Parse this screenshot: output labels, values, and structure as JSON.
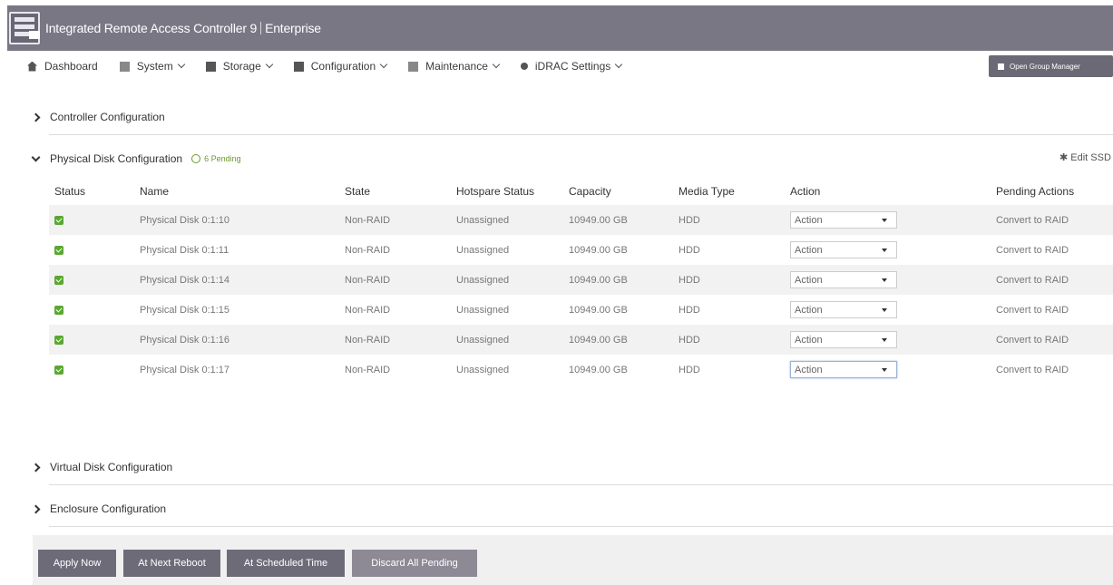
{
  "header": {
    "title": "Integrated Remote Access Controller 9",
    "edition": "Enterprise"
  },
  "nav": {
    "items": [
      {
        "label": "Dashboard",
        "icon": "home-icon"
      },
      {
        "label": "System",
        "icon": "server-icon"
      },
      {
        "label": "Storage",
        "icon": "storage-icon"
      },
      {
        "label": "Configuration",
        "icon": "configuration-icon"
      },
      {
        "label": "Maintenance",
        "icon": "maintenance-icon"
      },
      {
        "label": "iDRAC Settings",
        "icon": "key-icon"
      }
    ],
    "group_manager_label": "Open Group Manager"
  },
  "sections": {
    "controller": "Controller Configuration",
    "physical": "Physical Disk Configuration",
    "physical_pending": "6 Pending",
    "edit_ssd": "Edit SSD Wear T",
    "virtual": "Virtual Disk Configuration",
    "enclosure": "Enclosure Configuration"
  },
  "table": {
    "headers": [
      "Status",
      "Name",
      "State",
      "Hotspare Status",
      "Capacity",
      "Media Type",
      "Action",
      "Pending Actions"
    ],
    "rows": [
      {
        "name": "Physical Disk 0:1:10",
        "state": "Non-RAID",
        "hotspare": "Unassigned",
        "capacity": "10949.00 GB",
        "media": "HDD",
        "action": "Action",
        "pending": "Convert to RAID"
      },
      {
        "name": "Physical Disk 0:1:11",
        "state": "Non-RAID",
        "hotspare": "Unassigned",
        "capacity": "10949.00 GB",
        "media": "HDD",
        "action": "Action",
        "pending": "Convert to RAID"
      },
      {
        "name": "Physical Disk 0:1:14",
        "state": "Non-RAID",
        "hotspare": "Unassigned",
        "capacity": "10949.00 GB",
        "media": "HDD",
        "action": "Action",
        "pending": "Convert to RAID"
      },
      {
        "name": "Physical Disk 0:1:15",
        "state": "Non-RAID",
        "hotspare": "Unassigned",
        "capacity": "10949.00 GB",
        "media": "HDD",
        "action": "Action",
        "pending": "Convert to RAID"
      },
      {
        "name": "Physical Disk 0:1:16",
        "state": "Non-RAID",
        "hotspare": "Unassigned",
        "capacity": "10949.00 GB",
        "media": "HDD",
        "action": "Action",
        "pending": "Convert to RAID"
      },
      {
        "name": "Physical Disk 0:1:17",
        "state": "Non-RAID",
        "hotspare": "Unassigned",
        "capacity": "10949.00 GB",
        "media": "HDD",
        "action": "Action",
        "pending": "Convert to RAID"
      }
    ]
  },
  "footer": {
    "apply_now": "Apply Now",
    "next_reboot": "At Next Reboot",
    "scheduled": "At Scheduled Time",
    "discard": "Discard All Pending"
  },
  "colors": {
    "header_bg": "#7a7785",
    "status_ok": "#5aa832",
    "pending": "#6a9a2a",
    "button_bg": "#6e6b79"
  }
}
